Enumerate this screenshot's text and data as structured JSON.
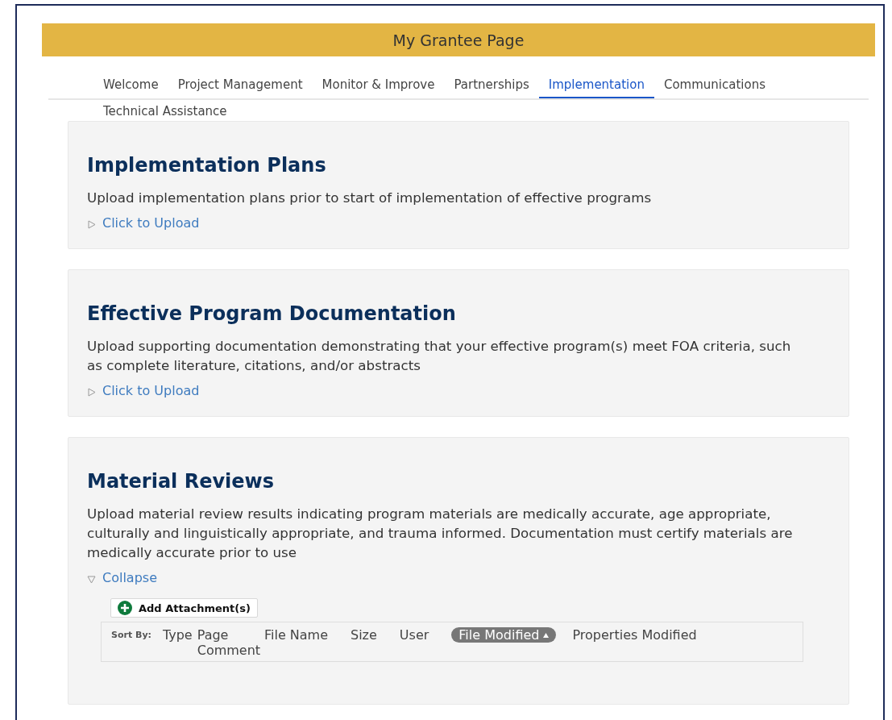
{
  "header": {
    "title": "My Grantee Page"
  },
  "tabs": [
    {
      "label": "Welcome",
      "selected": false
    },
    {
      "label": "Project Management",
      "selected": false
    },
    {
      "label": "Monitor & Improve",
      "selected": false
    },
    {
      "label": "Partnerships",
      "selected": false
    },
    {
      "label": "Implementation",
      "selected": true
    },
    {
      "label": "Communications",
      "selected": false
    },
    {
      "label": "Technical Assistance",
      "selected": false
    }
  ],
  "sections": [
    {
      "title": "Implementation Plans",
      "description": "Upload implementation plans prior to start of implementation of effective programs",
      "toggle": "Click to Upload",
      "expanded": false
    },
    {
      "title": "Effective Program Documentation",
      "description": "Upload supporting documentation demonstrating that your effective program(s) meet FOA criteria, such as complete literature, citations, and/or abstracts",
      "toggle": "Click to Upload",
      "expanded": false
    },
    {
      "title": "Material Reviews",
      "description": "Upload material review results indicating program materials are medically accurate, age appropriate, culturally and linguistically appropriate, and trauma informed. Documentation must certify materials are medically accurate prior to use",
      "toggle": "Collapse",
      "expanded": true,
      "add_button": "Add Attachment(s)",
      "sort_label": "Sort By:",
      "sort_fields": [
        {
          "label": "Type",
          "selected": false
        },
        {
          "label": "Page Comment",
          "selected": false
        },
        {
          "label": "File Name",
          "selected": false
        },
        {
          "label": "Size",
          "selected": false
        },
        {
          "label": "User",
          "selected": false
        },
        {
          "label": "File Modified",
          "selected": true
        },
        {
          "label": "Properties Modified",
          "selected": false
        }
      ]
    }
  ]
}
